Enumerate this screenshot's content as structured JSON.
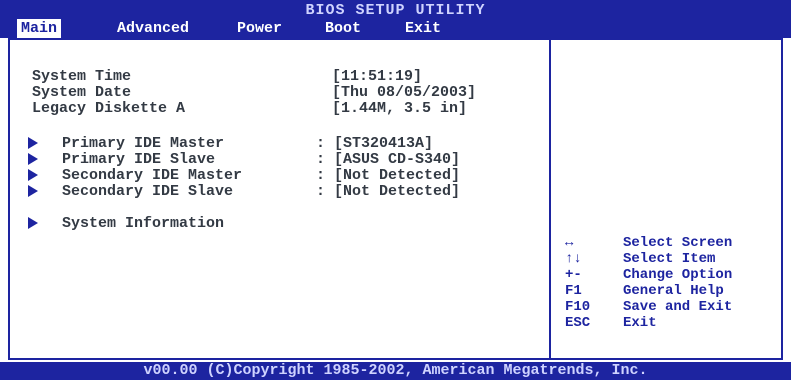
{
  "title": "BIOS SETUP UTILITY",
  "menu": {
    "items": [
      {
        "label": "Main",
        "active": true
      },
      {
        "label": "Advanced",
        "active": false
      },
      {
        "label": "Power",
        "active": false
      },
      {
        "label": "Boot",
        "active": false
      },
      {
        "label": "Exit",
        "active": false
      }
    ]
  },
  "fields": [
    {
      "label": "System Time",
      "value": "[11:51:19]"
    },
    {
      "label": "System Date",
      "value": "[Thu 08/05/2003]"
    },
    {
      "label": "Legacy Diskette A",
      "value": "[1.44M, 3.5 in]"
    }
  ],
  "submenus": [
    {
      "label": "Primary IDE Master",
      "value": ": [ST320413A]"
    },
    {
      "label": "Primary IDE Slave",
      "value": ": [ASUS CD-S340]"
    },
    {
      "label": "Secondary IDE Master",
      "value": ": [Not Detected]"
    },
    {
      "label": "Secondary IDE Slave",
      "value": ": [Not Detected]"
    },
    {
      "label": "System Information",
      "value": ""
    }
  ],
  "help_keys": [
    {
      "key": "↔",
      "desc": "Select Screen"
    },
    {
      "key": "↑↓",
      "desc": "Select Item"
    },
    {
      "key": "+-",
      "desc": "Change Option"
    },
    {
      "key": "F1",
      "desc": "General Help"
    },
    {
      "key": "F10",
      "desc": "Save and Exit"
    },
    {
      "key": "ESC",
      "desc": "Exit"
    }
  ],
  "footer": "v00.00 (C)Copyright 1985-2002, American Megatrends, Inc.",
  "colors": {
    "accent": "#1d24a0",
    "text": "#333a44",
    "background": "#ffffff"
  }
}
